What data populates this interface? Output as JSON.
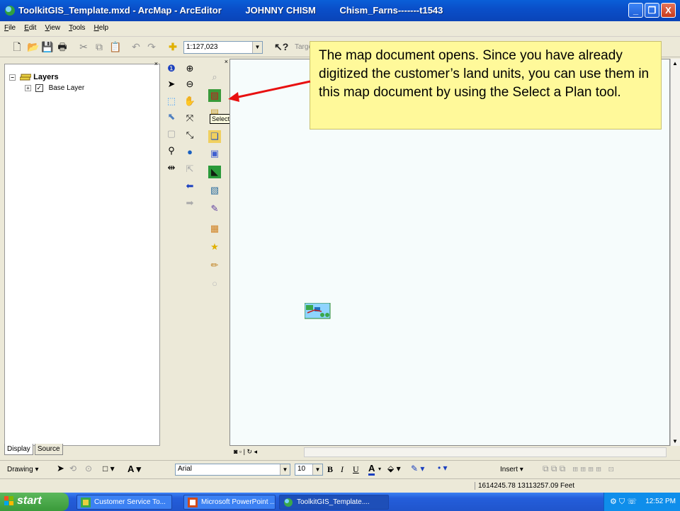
{
  "window": {
    "title_parts": [
      "ToolkitGIS_Template.mxd - ArcMap - ArcEditor",
      "JOHNNY CHISM",
      "Chism_Farns-------t1543"
    ],
    "minimize_glyph": "_",
    "maximize_glyph": "❐",
    "close_glyph": "X"
  },
  "menu": [
    "File",
    "Edit",
    "View",
    "Tools",
    "Help"
  ],
  "toolbar": {
    "scale": "1:127,023",
    "target_label": "Target"
  },
  "toc": {
    "root_label": "Layers",
    "layers": [
      {
        "label": "Base Layer",
        "checked": true
      }
    ],
    "tabs": [
      "Display",
      "Source"
    ]
  },
  "callout": {
    "text": "The map document opens. Since you have already digitized the customer’s land units, you can use them in this map document by using the Select a Plan tool."
  },
  "tooltip": "Select a Plan",
  "drawing": {
    "drawing_label": "Drawing ▾",
    "font": "Arial",
    "font_size": "10",
    "insert_label": "Insert ▾"
  },
  "status": {
    "coordinates": "1614245.78  13113257.09 Feet"
  },
  "taskbar": {
    "start_label": "start",
    "tasks": [
      {
        "label": "Customer Service To...",
        "active": false
      },
      {
        "label": "Microsoft PowerPoint ...",
        "active": false
      },
      {
        "label": "ToolkitGIS_Template....",
        "active": true
      }
    ],
    "clock": "12:52 PM"
  },
  "colors": {
    "callout_bg": "#fff99a",
    "arrow": "#e81010",
    "map_bg": "#f6fcfc"
  }
}
